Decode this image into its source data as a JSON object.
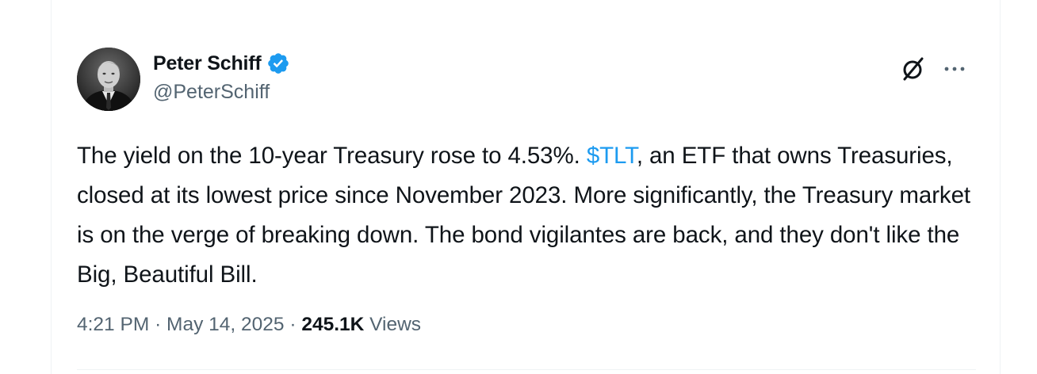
{
  "author": {
    "display_name": "Peter Schiff",
    "handle": "@PeterSchiff",
    "verified": true
  },
  "tweet": {
    "text_before": "The yield on the 10-year Treasury rose to 4.53%. ",
    "cashtag": "$TLT",
    "text_after": ", an ETF that owns Treasuries, closed at its lowest price since November 2023. More significantly, the Treasury market is on the verge of breaking down. The bond vigilantes are back, and they don't like the Big, Beautiful Bill."
  },
  "meta": {
    "time": "4:21 PM",
    "separator": "·",
    "date": "May 14, 2025",
    "views_count": "245.1K",
    "views_label": "Views"
  },
  "icons": {
    "verified": "verified-badge-icon",
    "grok": "grok-icon",
    "more": "more-options-icon"
  },
  "colors": {
    "accent": "#1d9bf0",
    "text_primary": "#0f1419",
    "text_secondary": "#536471",
    "divider": "#eff3f4"
  }
}
